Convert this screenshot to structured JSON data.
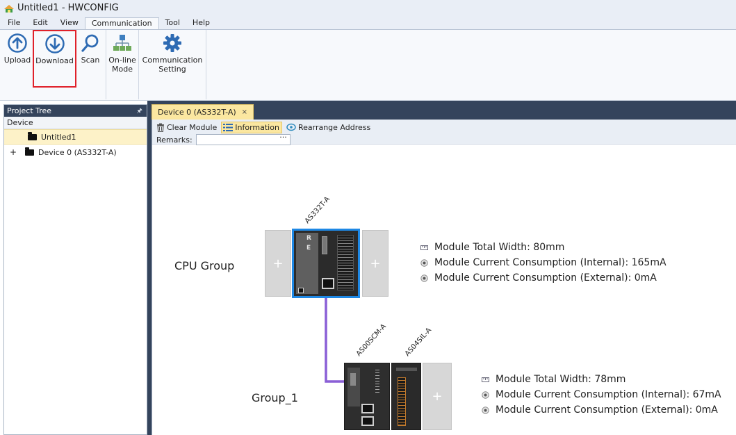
{
  "window": {
    "title": "Untitled1 - HWCONFIG"
  },
  "menu": [
    "File",
    "Edit",
    "View",
    "Communication",
    "Tool",
    "Help"
  ],
  "menu_active": "Communication",
  "ribbon": {
    "upload": "Upload",
    "download": "Download",
    "scan": "Scan",
    "online_l1": "On-line",
    "online_l2": "Mode",
    "comm_l1": "Communication",
    "comm_l2": "Setting"
  },
  "project_tree": {
    "title": "Project Tree",
    "section": "Device",
    "items": [
      {
        "label": "Untitled1",
        "selected": true
      },
      {
        "label": "Device 0 (AS332T-A)",
        "expand": "+"
      }
    ]
  },
  "document": {
    "tab_label": "Device 0 (AS332T-A)",
    "tab_close": "×",
    "toolbar": {
      "clear_module": "Clear Module",
      "information": "Information",
      "rearrange": "Rearrange Address",
      "remarks_label": "Remarks:",
      "remarks_value": "",
      "remarks_ellipsis": "···"
    }
  },
  "cpu_group": {
    "label": "CPU Group",
    "module": "AS332T-A",
    "led_r": "R",
    "led_e": "E",
    "slot_plus": "+",
    "info": [
      "Module Total Width: 80mm",
      "Module Current Consumption (Internal): 165mA",
      "Module Current Consumption (External): 0mA"
    ]
  },
  "group_1": {
    "label": "Group_1",
    "modules": [
      "AS00SCM-A",
      "AS04SIL-A"
    ],
    "slot_plus": "+",
    "info": [
      "Module Total Width: 78mm",
      "Module Current Consumption (Internal): 67mA",
      "Module Current Consumption (External): 0mA"
    ]
  },
  "colors": {
    "dark_frame": "#34445c",
    "highlight": "#fbe7a0",
    "download_outline": "#e0212a",
    "cpu_select": "#1e88e5",
    "link_line": "#8a5fd6",
    "icon_blue": "#2e6bb3"
  }
}
